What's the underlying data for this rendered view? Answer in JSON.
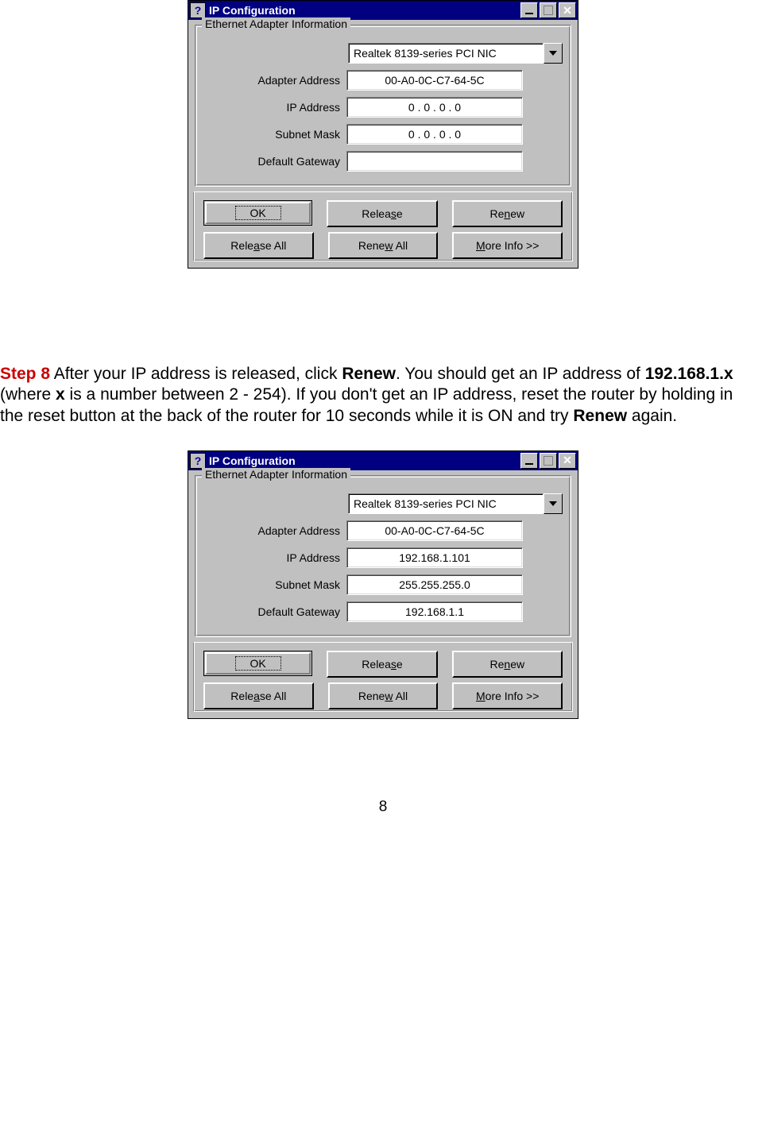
{
  "dialog1": {
    "title": "IP Configuration",
    "group_title": "Ethernet  Adapter Information",
    "adapter": "Realtek 8139-series PCI NIC",
    "labels": {
      "adapter_address": "Adapter Address",
      "ip_address": "IP Address",
      "subnet_mask": "Subnet Mask",
      "default_gateway": "Default Gateway"
    },
    "values": {
      "adapter_address": "00-A0-0C-C7-64-5C",
      "ip_address": "0 . 0 . 0 . 0",
      "subnet_mask": "0 . 0 . 0 . 0",
      "default_gateway": ""
    },
    "buttons": {
      "ok": "OK",
      "release": "Relea",
      "release_s": "s",
      "release_end": "e",
      "renew": "Re",
      "renew_n": "n",
      "renew_end": "ew",
      "release_all": "Rele",
      "release_all_a": "a",
      "release_all_end": "se All",
      "renew_all": "Rene",
      "renew_all_w": "w",
      "renew_all_end": " All",
      "more": "",
      "more_m": "M",
      "more_end": "ore Info >>"
    }
  },
  "step": {
    "label": "Step 8",
    "t1": " After your IP address is released, click ",
    "b1": "Renew",
    "t2": ". You should get an IP address of ",
    "b2": "192.168.1.x",
    "t3": " (where ",
    "b3": "x",
    "t4": " is a number between 2 - 254). If you don't get an IP address, reset the router by holding in the reset button at the back of the router for 10 seconds while it is ON and try ",
    "b4": "Renew",
    "t5": " again."
  },
  "dialog2": {
    "title": "IP Configuration",
    "group_title": "Ethernet  Adapter Information",
    "adapter": "Realtek 8139-series PCI NIC",
    "labels": {
      "adapter_address": "Adapter Address",
      "ip_address": "IP Address",
      "subnet_mask": "Subnet Mask",
      "default_gateway": "Default Gateway"
    },
    "values": {
      "adapter_address": "00-A0-0C-C7-64-5C",
      "ip_address": "192.168.1.101",
      "subnet_mask": "255.255.255.0",
      "default_gateway": "192.168.1.1"
    }
  },
  "pagenum": "8"
}
